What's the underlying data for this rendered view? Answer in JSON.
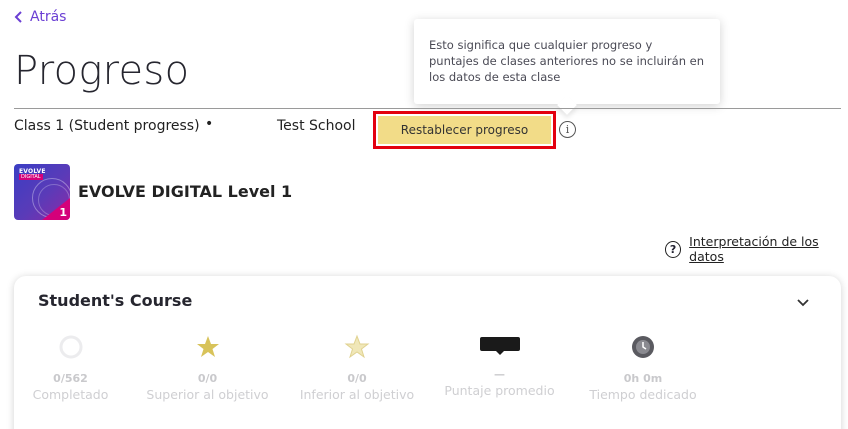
{
  "nav": {
    "back_label": "Atrás"
  },
  "page": {
    "title": "Progreso"
  },
  "class_info": {
    "class_name": "Class 1 (Student progress)",
    "separator": "•",
    "school": "Test School"
  },
  "reset": {
    "label": "Restablecer progreso",
    "tooltip": "Esto significa que cualquier progreso y puntajes de clases anteriores no se incluirán en los datos de esta clase",
    "info_icon": "info-icon"
  },
  "course": {
    "brand_line1": "EVOLVE",
    "brand_line2": "DIGITAL",
    "level_badge": "1",
    "name": "EVOLVE DIGITAL Level 1"
  },
  "help_link": {
    "label": "Interpretación de los datos",
    "icon": "question-circle-icon"
  },
  "student_course": {
    "title": "Student's Course",
    "expand_icon": "chevron-down-icon",
    "stats": [
      {
        "value": "0/562",
        "label": "Completado",
        "icon": "progress-circle-icon"
      },
      {
        "value": "0/0",
        "label": "Superior al objetivo",
        "icon": "star-icon"
      },
      {
        "value": "0/0",
        "label": "Inferior al objetivo",
        "icon": "star-outline-icon"
      },
      {
        "value": "—",
        "label": "Puntaje promedio",
        "icon": "score-badge-icon"
      },
      {
        "value": "0h 0m",
        "label": "Tiempo dedicado",
        "icon": "clock-icon"
      }
    ]
  },
  "colors": {
    "accent": "#6b3fd4",
    "reset_button": "#f2dc88",
    "highlight_outline": "#e3000f",
    "star_gold": "#d8c35a"
  }
}
